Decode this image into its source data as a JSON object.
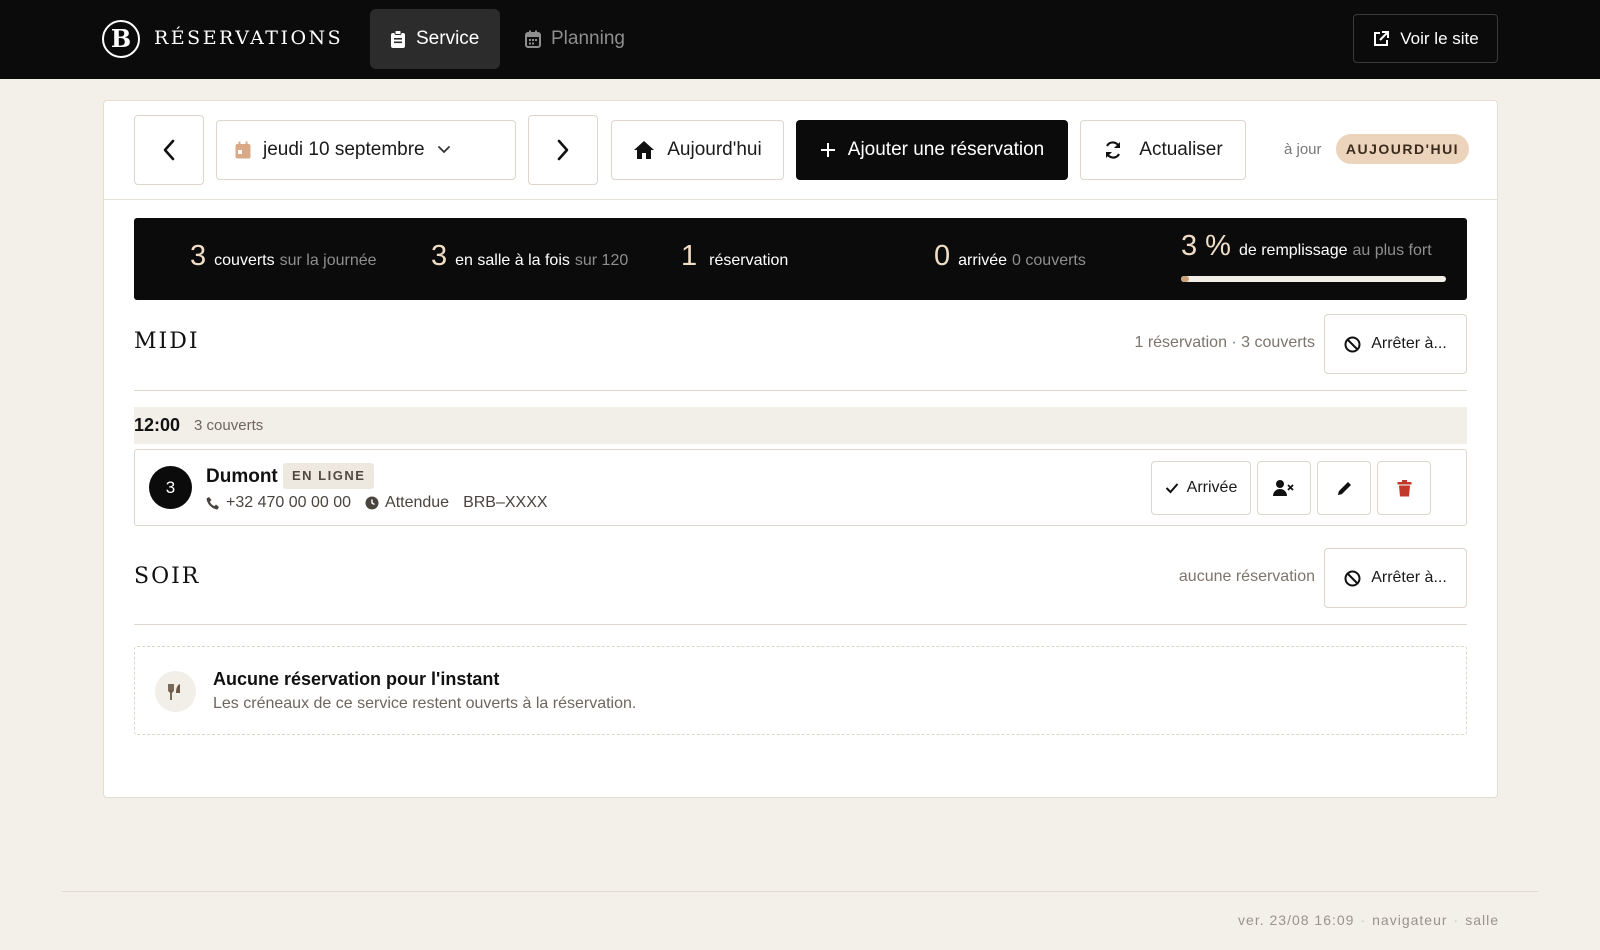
{
  "header": {
    "logo_letter": "B",
    "brand": "RÉSERVATIONS",
    "tabs": [
      {
        "label": "Service",
        "icon": "clipboard-icon",
        "active": true
      },
      {
        "label": "Planning",
        "icon": "calendar-icon",
        "active": false
      }
    ],
    "view_site": "Voir le site"
  },
  "toolbar": {
    "date_label": "jeudi 10 septembre",
    "today_label": "Aujourd'hui",
    "add_label": "Ajouter une réservation",
    "refresh_label": "Actualiser",
    "status_text": "à jour",
    "status_badge": "AUJOURD'HUI",
    "accent_color": "#ecd3bb"
  },
  "stats": {
    "covers_day": {
      "value": "3",
      "label": "couverts",
      "sub": "sur la journée"
    },
    "in_room": {
      "value": "3",
      "label": "en salle à la fois",
      "sub": "sur 120"
    },
    "reservations": {
      "value": "1",
      "label": "réservation"
    },
    "arrived": {
      "value": "0",
      "label": "arrivée",
      "sub": "0 couverts"
    },
    "fill": {
      "value": "3 %",
      "label": "de remplissage",
      "sub": "au plus fort",
      "fraction": 0.03
    }
  },
  "services": [
    {
      "title": "MIDI",
      "summary": "1 réservation · 3 couverts",
      "stop_label": "Arrêter à...",
      "slots": [
        {
          "time": "12:00",
          "covers": "3 couverts",
          "reservations": [
            {
              "party_size": "3",
              "name": "Dumont",
              "source": "EN LIGNE",
              "phone": "+32 470 00 00 00",
              "status": "Attendue",
              "ref": "BRB–XXXX",
              "arrived_label": "Arrivée"
            }
          ]
        }
      ]
    },
    {
      "title": "SOIR",
      "summary": "aucune réservation",
      "stop_label": "Arrêter à...",
      "empty_title": "Aucune réservation pour l'instant",
      "empty_text": "Les créneaux de ce service restent ouverts à la réservation."
    }
  ],
  "footer": {
    "version": "ver. 23/08 16:09",
    "client": "navigateur",
    "mode": "salle"
  },
  "colors": {
    "danger": "#c0392b",
    "gold": "#c9a27c",
    "dark": "#0b0b0b"
  }
}
